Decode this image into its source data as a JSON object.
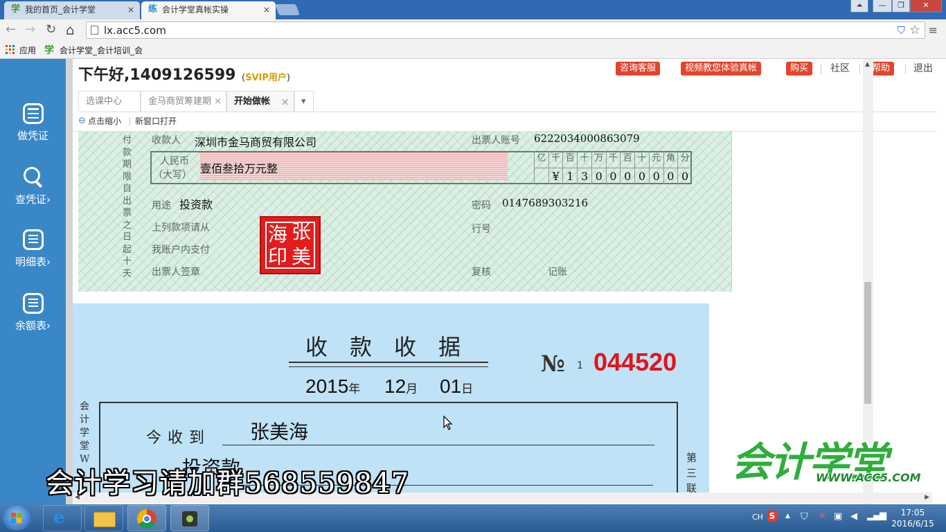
{
  "browser": {
    "tabs": [
      {
        "icon": "学",
        "title": "我的首页_会计学堂",
        "close": "×"
      },
      {
        "icon": "练",
        "title": "会计学堂真帐实操",
        "close": "×"
      }
    ],
    "window_controls": {
      "user": "⏶",
      "minimize": "—",
      "maximize": "❐",
      "close": "✕"
    },
    "nav": {
      "back": "←",
      "forward": "→",
      "reload": "↻",
      "home": "⌂"
    },
    "url": "lx.acc5.com",
    "bookmarks": {
      "apps": "应用",
      "item1_icon": "学",
      "item1": "会计学堂_会计培训_会"
    },
    "colors": {
      "accent_blue": "#2f6ab3",
      "sidebar_blue": "#3a87c7",
      "button_red": "#e0462c"
    }
  },
  "sidebar": {
    "items": [
      {
        "label": "做凭证",
        "icon": "calculator-icon"
      },
      {
        "label": "查凭证",
        "arrow": "›",
        "icon": "search-icon"
      },
      {
        "label": "明细表",
        "arrow": "›",
        "icon": "list-icon"
      },
      {
        "label": "余额表",
        "arrow": "›",
        "icon": "list-icon"
      }
    ]
  },
  "header": {
    "greeting": "下午好,1409126599",
    "svip_open": "(",
    "svip_label": "SVIP用户",
    "svip_close": ")",
    "buttons": [
      "咨询客服",
      "视频教您体验真帐",
      "购买"
    ],
    "community": "社区",
    "help": "帮助",
    "logout": "退出"
  },
  "inner_tabs": [
    {
      "label": "选课中心"
    },
    {
      "label": "金马商贸筹建期",
      "close": "×"
    },
    {
      "label": "开始做帐",
      "close": "×"
    }
  ],
  "inner_tabs_more": "▾",
  "operations": {
    "zoom_out": "点击缩小",
    "new_window": "新窗口打开"
  },
  "cheque": {
    "vertical_text": "付款期限自出票之日起十天",
    "payee_label": "收款人",
    "payee": "深圳市金马商贸有限公司",
    "account_label": "出票人账号",
    "account": "6222034000863079",
    "rmb_label": "人民币",
    "rmb_label2": "（大写）",
    "amount_words": "壹佰叁拾万元整",
    "digit_headers": [
      "亿",
      "千",
      "百",
      "十",
      "万",
      "千",
      "百",
      "十",
      "元",
      "角",
      "分"
    ],
    "digit_values": [
      "",
      "¥",
      "1",
      "3",
      "0",
      "0",
      "0",
      "0",
      "0",
      "0",
      "0"
    ],
    "purpose_label": "用途",
    "purpose": "投资款",
    "password_label": "密码",
    "password": "0147689303216",
    "line1": "上列款项请从",
    "line2": "我账户内支付",
    "bank_label": "行号",
    "signer_label": "出票人签章",
    "review_label": "复核",
    "bookkeep_label": "记账",
    "seal_chars": [
      "张",
      "海",
      "美",
      "印"
    ]
  },
  "receipt": {
    "title": "收款收据",
    "no_label": "№",
    "no_small": "1",
    "number": "044520",
    "year": "2015",
    "year_unit": "年",
    "month": "12",
    "month_unit": "月",
    "day": "01",
    "day_unit": "日",
    "vertical_left": "会计学堂W",
    "vertical_right": "第三联",
    "received_label": "今收到",
    "payer": "张美海",
    "purpose": "投资款"
  },
  "overlay": {
    "watermark": "会计学习请加群568559847",
    "logo_cn": "会计学堂",
    "logo_en": "WWW.ACC5.COM"
  },
  "taskbar": {
    "tray_lang": "CH",
    "tray_ime": "S",
    "tray_up": "▲",
    "time": "17:05",
    "date": "2016/6/15"
  },
  "scroll": {
    "up": "▲",
    "down": "▼",
    "left": "◀",
    "right": "▶"
  }
}
